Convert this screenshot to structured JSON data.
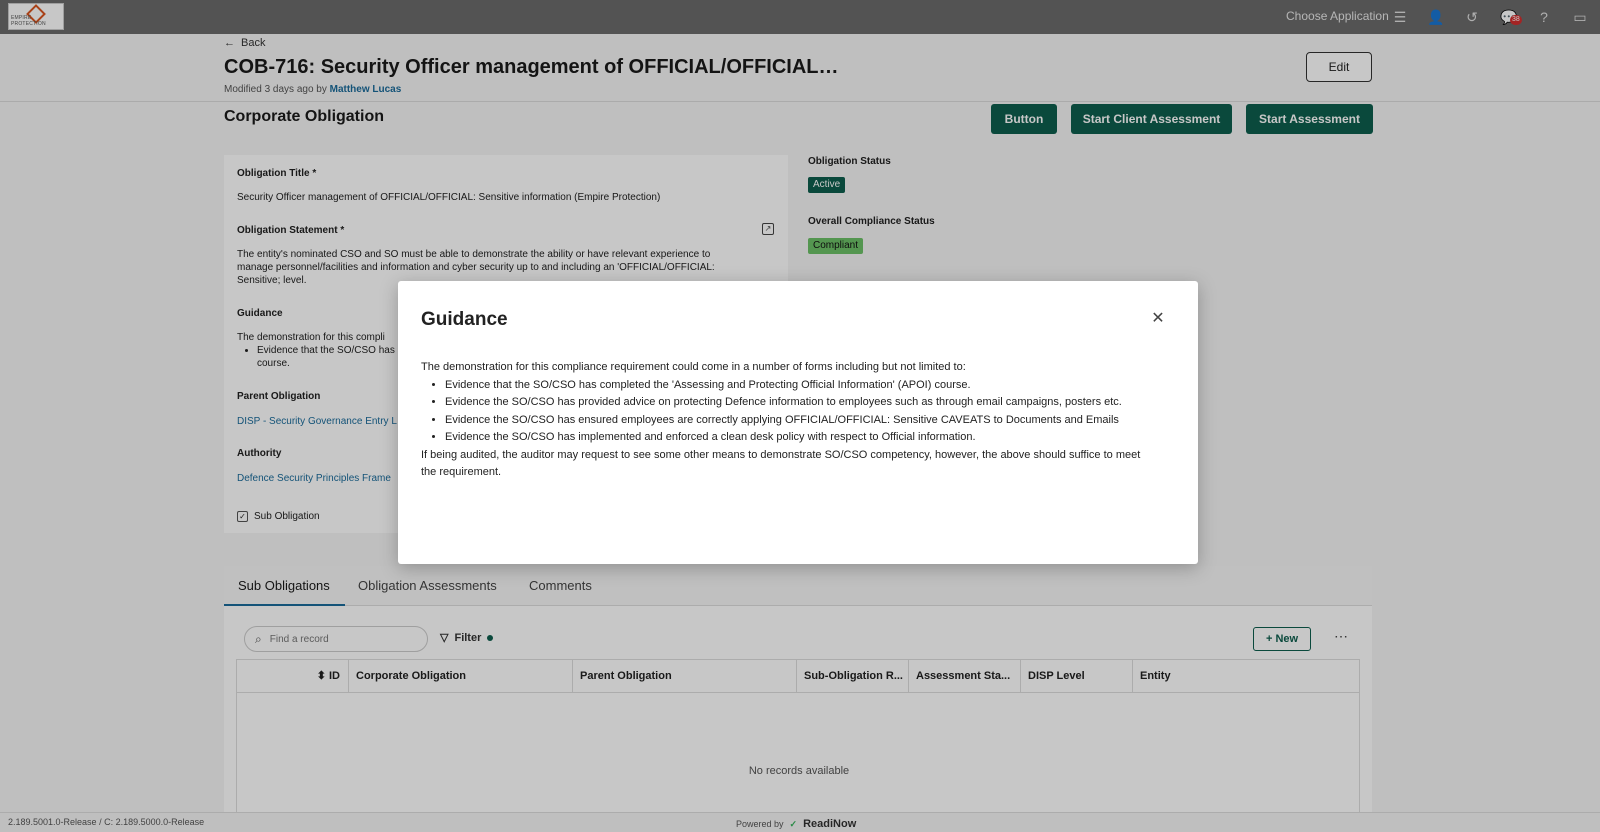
{
  "topbar": {
    "logo_text": "EMPIRE PROTECTION",
    "choose_app": "Choose Application",
    "notification_count": "38"
  },
  "header": {
    "back": "Back",
    "title": "COB-716: Security Officer management of OFFICIAL/OFFICIAL…",
    "modified_prefix": "Modified 3 days ago by",
    "modified_by": "Matthew Lucas",
    "edit": "Edit"
  },
  "section": {
    "title": "Corporate Obligation",
    "buttons": [
      "Button",
      "Start Client Assessment",
      "Start Assessment"
    ]
  },
  "form": {
    "obligation_title_label": "Obligation Title *",
    "obligation_title": "Security Officer management of OFFICIAL/OFFICIAL: Sensitive information (Empire Protection)",
    "statement_label": "Obligation Statement *",
    "statement": "The entity's nominated CSO and SO must be able to demonstrate the ability or have relevant experience to manage personnel/facilities and information and cyber security up to and including an 'OFFICIAL/OFFICIAL: Sensitive; level.",
    "guidance_label": "Guidance",
    "guidance_intro": "The demonstration for this compli",
    "guidance_item1": "Evidence that the SO/CSO has",
    "guidance_item1b": "course.",
    "parent_label": "Parent Obligation",
    "parent_value": "DISP - Security Governance Entry L",
    "authority_label": "Authority",
    "authority_value": "Defence Security Principles Frame",
    "sub_obligation": "Sub Obligation"
  },
  "status": {
    "obligation_status_label": "Obligation Status",
    "obligation_status": "Active",
    "compliance_label": "Overall Compliance Status",
    "compliance": "Compliant",
    "colors": {
      "active": "#0e5e4d",
      "compliant": "#6cc067"
    }
  },
  "tabs": [
    "Sub Obligations",
    "Obligation Assessments",
    "Comments"
  ],
  "table": {
    "search_placeholder": "Find a record",
    "filter": "Filter",
    "new": "New",
    "columns": [
      "ID",
      "Corporate Obligation",
      "Parent Obligation",
      "Sub-Obligation R...",
      "Assessment Sta...",
      "DISP Level",
      "Entity"
    ],
    "empty": "No records available"
  },
  "footer": {
    "version": "2.189.5001.0-Release / C: 2.189.5000.0-Release",
    "powered": "Powered by",
    "brand": "ReadiNow"
  },
  "modal": {
    "title": "Guidance",
    "intro": "The demonstration for this compliance requirement could come in a number of forms including but not limited to:",
    "items": [
      "Evidence that the SO/CSO has completed the 'Assessing and Protecting Official Information' (APOI) course.",
      "Evidence the SO/CSO has provided advice on protecting Defence information to employees such as through email campaigns, posters etc.",
      "Evidence the SO/CSO has ensured employees are correctly applying OFFICIAL/OFFICIAL: Sensitive CAVEATS to Documents and Emails",
      "Evidence the SO/CSO has implemented and enforced a clean desk policy with respect to Official information."
    ],
    "outro": "If being audited, the auditor may request to see some other means to demonstrate SO/CSO competency, however, the above should suffice to meet the requirement."
  }
}
